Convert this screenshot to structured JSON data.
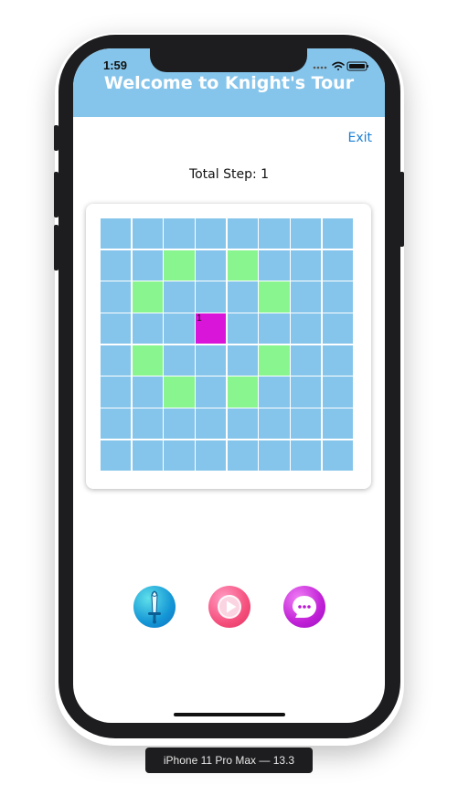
{
  "status_bar": {
    "time": "1:59"
  },
  "header": {
    "title": "Welcome to Knight's Tour"
  },
  "exit_label": "Exit",
  "total_step": "Total Step: 1",
  "board": {
    "rows": 8,
    "cols": 8,
    "visited": [
      {
        "row": 3,
        "col": 3,
        "label": "1"
      }
    ],
    "possible_moves": [
      {
        "row": 1,
        "col": 2
      },
      {
        "row": 1,
        "col": 4
      },
      {
        "row": 2,
        "col": 1
      },
      {
        "row": 2,
        "col": 5
      },
      {
        "row": 4,
        "col": 1
      },
      {
        "row": 4,
        "col": 5
      },
      {
        "row": 5,
        "col": 2
      },
      {
        "row": 5,
        "col": 4
      }
    ],
    "colors": {
      "empty": "#86c5eb",
      "move": "#88f58f",
      "visited": "#d915d9"
    }
  },
  "actions": [
    {
      "icon": "sword-icon"
    },
    {
      "icon": "play-icon"
    },
    {
      "icon": "chat-bubble-icon"
    }
  ],
  "device_label": "iPhone 11 Pro Max — 13.3"
}
